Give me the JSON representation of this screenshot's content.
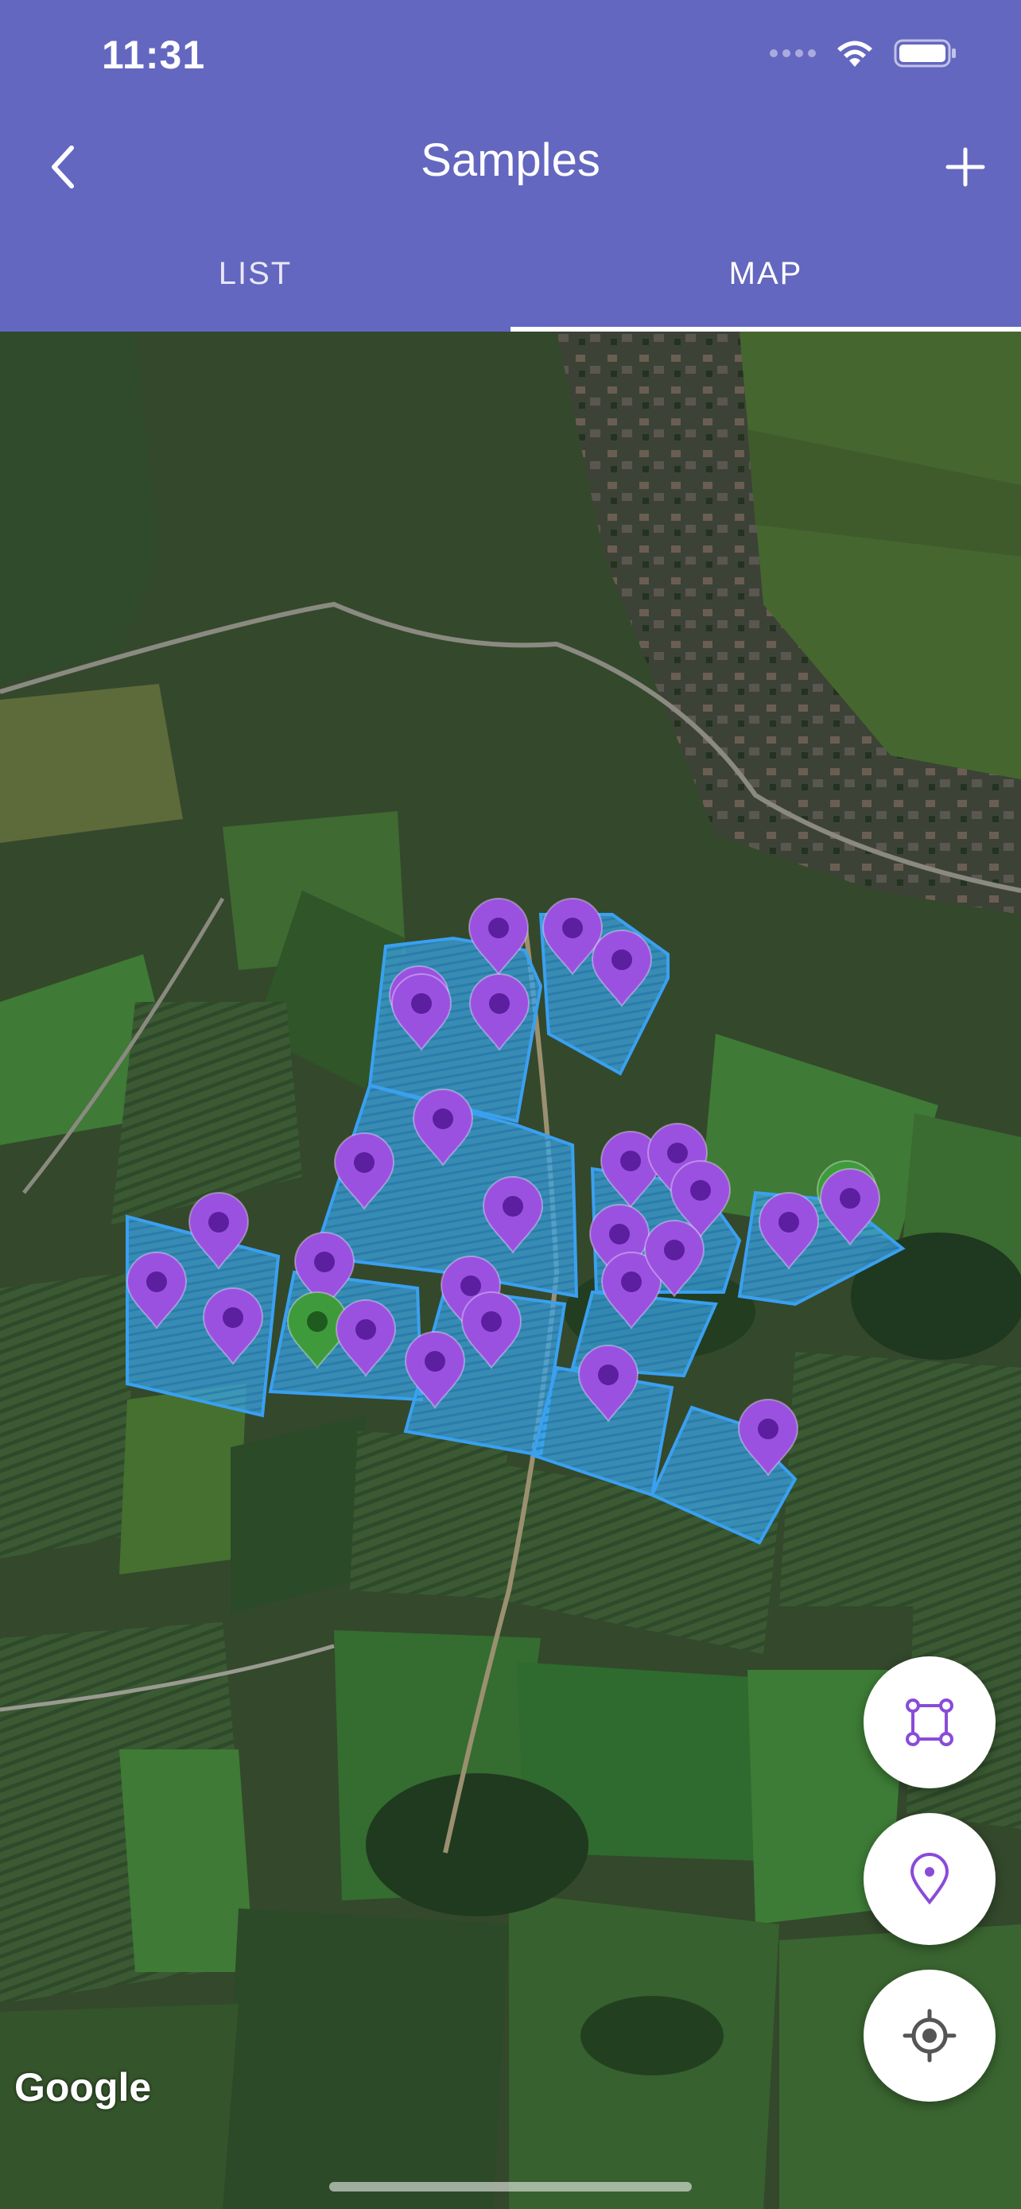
{
  "status": {
    "time": "11:31"
  },
  "header": {
    "title": "Samples"
  },
  "tabs": [
    {
      "label": "LIST"
    },
    {
      "label": "MAP"
    }
  ],
  "map": {
    "attribution": "Google"
  },
  "colors": {
    "header": "#6467c0",
    "field_fill": "#3aa5e6",
    "pin_purple": "#9b51e0",
    "pin_green": "#3f9a3b",
    "icon_accent": "#8a4bd8"
  },
  "icons": [
    "back-chevron-icon",
    "add-icon",
    "draw-polygon-icon",
    "add-pin-icon",
    "my-location-icon"
  ]
}
